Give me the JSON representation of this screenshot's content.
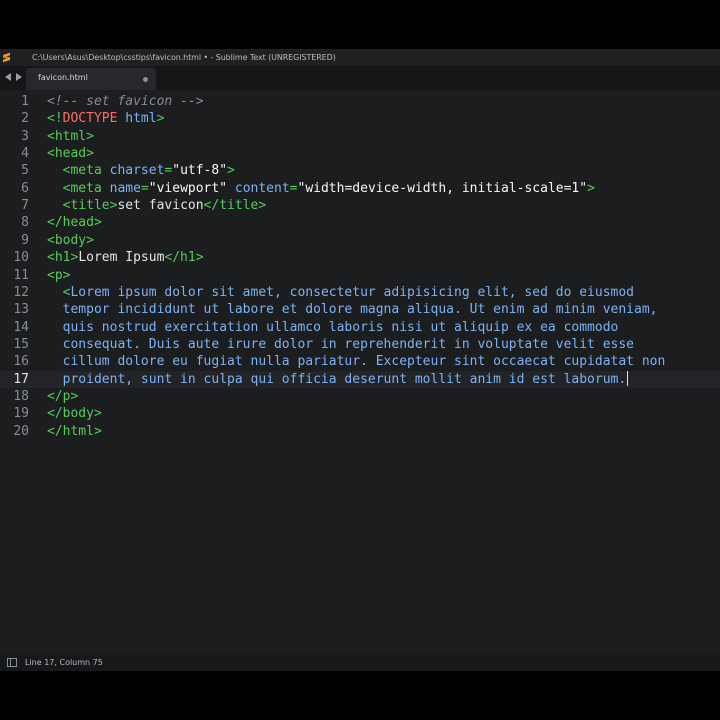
{
  "window": {
    "title": "C:\\Users\\Asus\\Desktop\\csstips\\favicon.html • - Sublime Text (UNREGISTERED)",
    "app_icon": "sublime-text-icon"
  },
  "tabs": [
    {
      "label": "favicon.html",
      "modified": true
    }
  ],
  "nav": {
    "back_icon": "arrow-left-icon",
    "forward_icon": "arrow-right-icon"
  },
  "editor": {
    "current_line": 17,
    "lines": [
      {
        "n": "1",
        "segments": [
          [
            "cmt",
            "<!-- set favicon -->"
          ]
        ]
      },
      {
        "n": "2",
        "segments": [
          [
            "tag",
            "<!"
          ],
          [
            "doctype",
            "DOCTYPE"
          ],
          [
            "tag",
            " "
          ],
          [
            "attr",
            "html"
          ],
          [
            "tag",
            ">"
          ]
        ]
      },
      {
        "n": "3",
        "segments": [
          [
            "tag",
            "<html>"
          ]
        ]
      },
      {
        "n": "4",
        "segments": [
          [
            "tag",
            "<head>"
          ]
        ]
      },
      {
        "n": "5",
        "segments": [
          [
            "txt",
            "  "
          ],
          [
            "tag",
            "<meta "
          ],
          [
            "attr",
            "charset"
          ],
          [
            "tag",
            "="
          ],
          [
            "str",
            "\"utf-8\""
          ],
          [
            "tag",
            ">"
          ]
        ]
      },
      {
        "n": "6",
        "segments": [
          [
            "txt",
            "  "
          ],
          [
            "tag",
            "<meta "
          ],
          [
            "attr",
            "name"
          ],
          [
            "tag",
            "="
          ],
          [
            "str",
            "\"viewport\""
          ],
          [
            "tag",
            " "
          ],
          [
            "attr",
            "content"
          ],
          [
            "tag",
            "="
          ],
          [
            "str",
            "\"width=device-width, initial-scale=1\""
          ],
          [
            "tag",
            ">"
          ]
        ]
      },
      {
        "n": "7",
        "segments": [
          [
            "txt",
            "  "
          ],
          [
            "tag",
            "<title>"
          ],
          [
            "txt",
            "set favicon"
          ],
          [
            "tag",
            "</title>"
          ]
        ]
      },
      {
        "n": "8",
        "segments": [
          [
            "tag",
            "</head>"
          ]
        ]
      },
      {
        "n": "9",
        "segments": [
          [
            "tag",
            "<body>"
          ]
        ]
      },
      {
        "n": "10",
        "segments": [
          [
            "tag",
            "<h1>"
          ],
          [
            "txt",
            "Lorem Ipsum"
          ],
          [
            "tag",
            "</h1>"
          ]
        ]
      },
      {
        "n": "11",
        "segments": [
          [
            "tag",
            "<p>"
          ]
        ]
      },
      {
        "n": "12",
        "segments": [
          [
            "txt",
            "  "
          ],
          [
            "tag",
            "<"
          ],
          [
            "lorem",
            "Lorem ipsum dolor sit amet, consectetur adipisicing elit, sed do eiusmod"
          ]
        ]
      },
      {
        "n": "13",
        "segments": [
          [
            "txt",
            "  "
          ],
          [
            "lorem",
            "tempor incididunt ut labore et dolore magna aliqua. Ut enim ad minim veniam,"
          ]
        ]
      },
      {
        "n": "14",
        "segments": [
          [
            "txt",
            "  "
          ],
          [
            "lorem",
            "quis nostrud exercitation ullamco laboris nisi ut aliquip ex ea commodo"
          ]
        ]
      },
      {
        "n": "15",
        "segments": [
          [
            "txt",
            "  "
          ],
          [
            "lorem",
            "consequat. Duis aute irure dolor in reprehenderit in voluptate velit esse"
          ]
        ]
      },
      {
        "n": "16",
        "segments": [
          [
            "txt",
            "  "
          ],
          [
            "lorem",
            "cillum dolore eu fugiat nulla pariatur. Excepteur sint occaecat cupidatat non"
          ]
        ]
      },
      {
        "n": "17",
        "segments": [
          [
            "txt",
            "  "
          ],
          [
            "lorem",
            "proident, sunt in culpa qui officia deserunt mollit anim id est laborum."
          ]
        ]
      },
      {
        "n": "18",
        "segments": [
          [
            "tag",
            "</p>"
          ]
        ]
      },
      {
        "n": "19",
        "segments": [
          [
            "tag",
            "</body>"
          ]
        ]
      },
      {
        "n": "20",
        "segments": [
          [
            "tag",
            "</html>"
          ]
        ]
      }
    ]
  },
  "status": {
    "position": "Line 17, Column 75",
    "panel_icon": "sidebar-toggle-icon"
  },
  "colors": {
    "tag": "#57cc5a",
    "attribute": "#7bb3f5",
    "doctype": "#ff6a6a",
    "comment": "#8a8d92",
    "background": "#1c1d1f"
  }
}
